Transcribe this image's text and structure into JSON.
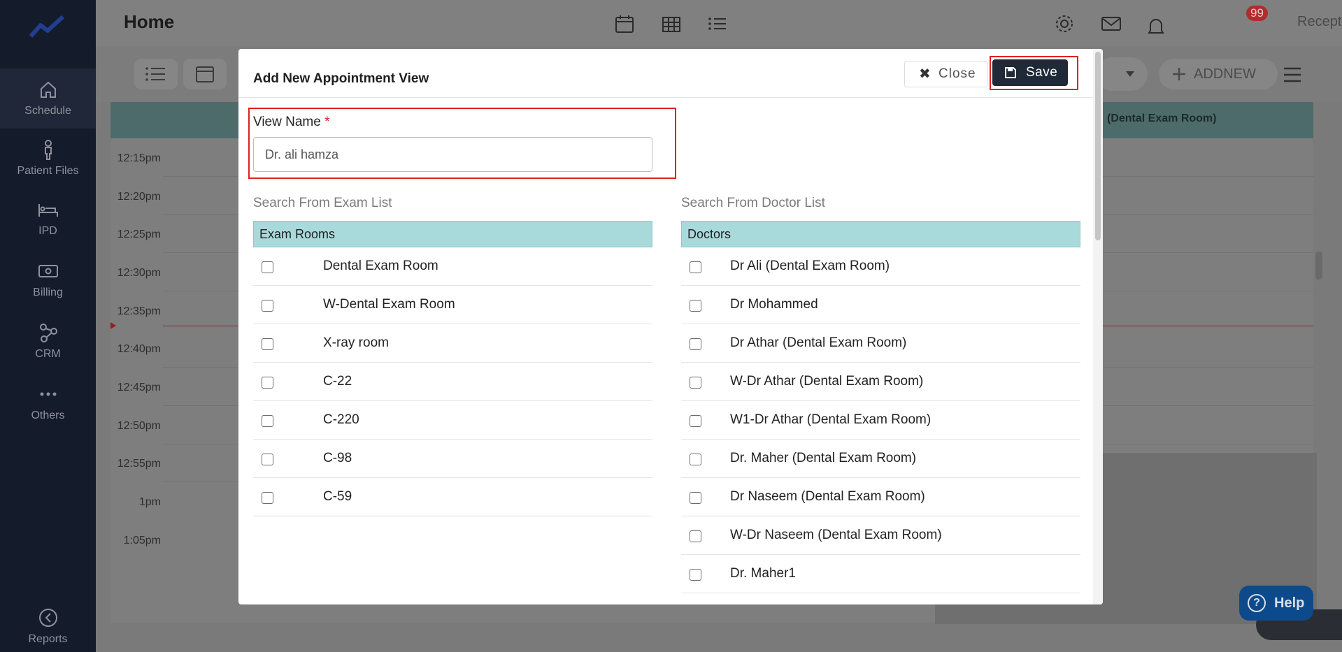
{
  "sidebar": {
    "items": [
      {
        "label": "Schedule",
        "icon": "home-icon"
      },
      {
        "label": "Patient Files",
        "icon": "person-icon"
      },
      {
        "label": "IPD",
        "icon": "bed-icon"
      },
      {
        "label": "Billing",
        "icon": "money-icon"
      },
      {
        "label": "CRM",
        "icon": "network-icon"
      },
      {
        "label": "Others",
        "icon": "dots-icon"
      },
      {
        "label": "Reports",
        "icon": "reports-icon"
      }
    ]
  },
  "topbar": {
    "title": "Home",
    "notification_count": "99",
    "user_role": "Receptionist"
  },
  "toolbar": {
    "add_new_label": "ADDNEW"
  },
  "calendar": {
    "column_header": "(Dental Exam Room)",
    "times": [
      "12:15pm",
      "12:20pm",
      "12:25pm",
      "12:30pm",
      "12:35pm",
      "12:40pm",
      "12:45pm",
      "12:50pm",
      "12:55pm",
      "1pm",
      "1:05pm"
    ]
  },
  "help": {
    "label": "Help"
  },
  "modal": {
    "title": "Add New Appointment View",
    "close_label": "Close",
    "save_label": "Save",
    "view_name_label": "View Name",
    "required_mark": "*",
    "view_name_value": "Dr. ali hamza",
    "exam": {
      "search_label": "Search From Exam List",
      "header": "Exam Rooms",
      "items": [
        "Dental Exam Room",
        "W-Dental Exam Room",
        "X-ray room",
        "C-22",
        "C-220",
        "C-98",
        "C-59"
      ]
    },
    "doctor": {
      "search_label": "Search From Doctor List",
      "header": "Doctors",
      "items": [
        "Dr Ali (Dental Exam Room)",
        "Dr Mohammed",
        "Dr Athar (Dental Exam Room)",
        "W-Dr Athar (Dental Exam Room)",
        "W1-Dr Athar (Dental Exam Room)",
        "Dr. Maher (Dental Exam Room)",
        "Dr Naseem (Dental Exam Room)",
        "W-Dr Naseem (Dental Exam Room)",
        "Dr. Maher1"
      ]
    }
  },
  "colors": {
    "sidebar_bg": "#141b2b",
    "list_header_bg": "#a8dadc",
    "save_bg": "#1f2937",
    "highlight_outline": "#e02020",
    "help_bg": "#0d4a8c"
  }
}
